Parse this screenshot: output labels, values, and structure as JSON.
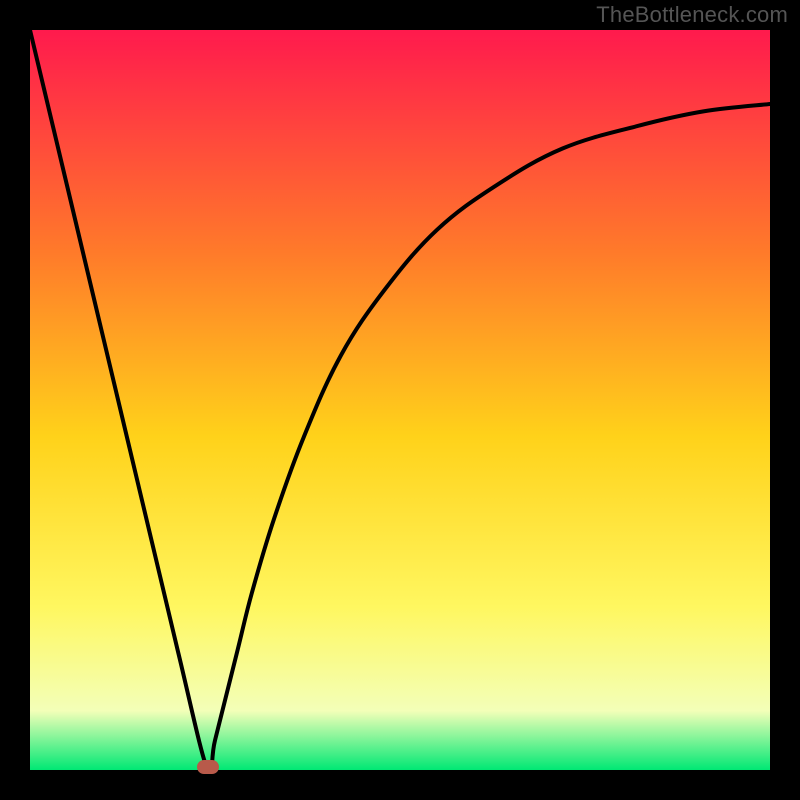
{
  "watermark": "TheBottleneck.com",
  "colors": {
    "frame": "#000000",
    "gradient_top": "#ff1a4d",
    "gradient_mid_upper": "#ff7a2a",
    "gradient_mid": "#ffd21a",
    "gradient_mid_lower": "#fff760",
    "gradient_lower": "#f3ffb8",
    "gradient_bottom": "#00e874",
    "curve": "#000000",
    "marker": "#b85a4a"
  },
  "chart_data": {
    "type": "line",
    "title": "",
    "xlabel": "",
    "ylabel": "",
    "xlim": [
      0,
      100
    ],
    "ylim": [
      0,
      100
    ],
    "series": [
      {
        "name": "bottleneck-curve",
        "x": [
          0,
          5,
          10,
          15,
          20,
          24,
          25,
          28,
          30,
          33,
          37,
          42,
          48,
          55,
          63,
          72,
          82,
          91,
          100
        ],
        "values": [
          100,
          79,
          58,
          37,
          16,
          0,
          4,
          16,
          24,
          34,
          45,
          56,
          65,
          73,
          79,
          84,
          87,
          89,
          90
        ]
      }
    ],
    "marker": {
      "x": 24,
      "y": 0,
      "name": "optimal-point"
    },
    "grid": false,
    "legend": false
  }
}
